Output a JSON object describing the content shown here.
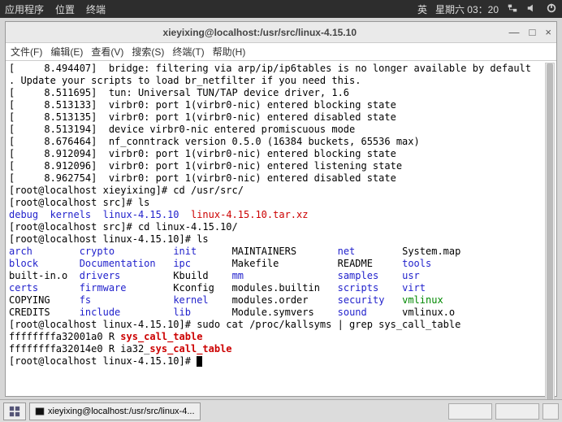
{
  "topbar": {
    "apps": "应用程序",
    "places": "位置",
    "term": "终端",
    "ime": "英",
    "clock": "星期六 03：20"
  },
  "window": {
    "title": "xieyixing@localhost:/usr/src/linux-4.15.10",
    "min": "—",
    "max": "□",
    "close": "×"
  },
  "menu": {
    "file": "文件(F)",
    "edit": "编辑(E)",
    "view": "查看(V)",
    "search": "搜索(S)",
    "terminal": "终端(T)",
    "help": "帮助(H)"
  },
  "dmesg": [
    "[     8.494407]  bridge: filtering via arp/ip/ip6tables is no longer available by default",
    ". Update your scripts to load br_netfilter if you need this.",
    "[     8.511695]  tun: Universal TUN/TAP device driver, 1.6",
    "[     8.513133]  virbr0: port 1(virbr0-nic) entered blocking state",
    "[     8.513135]  virbr0: port 1(virbr0-nic) entered disabled state",
    "[     8.513194]  device virbr0-nic entered promiscuous mode",
    "[     8.676464]  nf_conntrack version 0.5.0 (16384 buckets, 65536 max)",
    "[     8.912094]  virbr0: port 1(virbr0-nic) entered blocking state",
    "[     8.912096]  virbr0: port 1(virbr0-nic) entered listening state",
    "[     8.962754]  virbr0: port 1(virbr0-nic) entered disabled state"
  ],
  "prompts": {
    "p1": "[root@localhost xieyixing]# cd /usr/src/",
    "p2": "[root@localhost src]# ls",
    "p3": "[root@localhost src]# cd linux-4.15.10/",
    "p4": "[root@localhost linux-4.15.10]# ls",
    "p5": "[root@localhost linux-4.15.10]# sudo cat /proc/kallsyms | grep sys_call_table",
    "p6": "[root@localhost linux-4.15.10]# "
  },
  "ls_src": {
    "debug": "debug",
    "kernels": "kernels",
    "linux": "linux-4.15.10",
    "tarball": "linux-4.15.10.tar.xz"
  },
  "ls_linux": {
    "c1": [
      "arch",
      "block",
      "built-in.o",
      "certs",
      "COPYING",
      "CREDITS"
    ],
    "c2": [
      "crypto",
      "Documentation",
      "drivers",
      "firmware",
      "fs",
      "include"
    ],
    "c3": [
      "init",
      "ipc",
      "Kbuild",
      "Kconfig",
      "kernel",
      "lib"
    ],
    "c4": [
      "MAINTAINERS",
      "Makefile",
      "mm",
      "modules.builtin",
      "modules.order",
      "Module.symvers"
    ],
    "c5": [
      "net",
      "README",
      "samples",
      "scripts",
      "security",
      "sound"
    ],
    "c6": [
      "System.map",
      "tools",
      "usr",
      "virt",
      "vmlinux",
      "vmlinux.o"
    ]
  },
  "kallsyms": {
    "l1a": "ffffffffa32001a0 R ",
    "l1b": "sys_call_table",
    "l2a": "ffffffffa32014e0 R ia32_",
    "l2b": "sys_call_table"
  },
  "taskbar": {
    "task": "xieyixing@localhost:/usr/src/linux-4..."
  }
}
